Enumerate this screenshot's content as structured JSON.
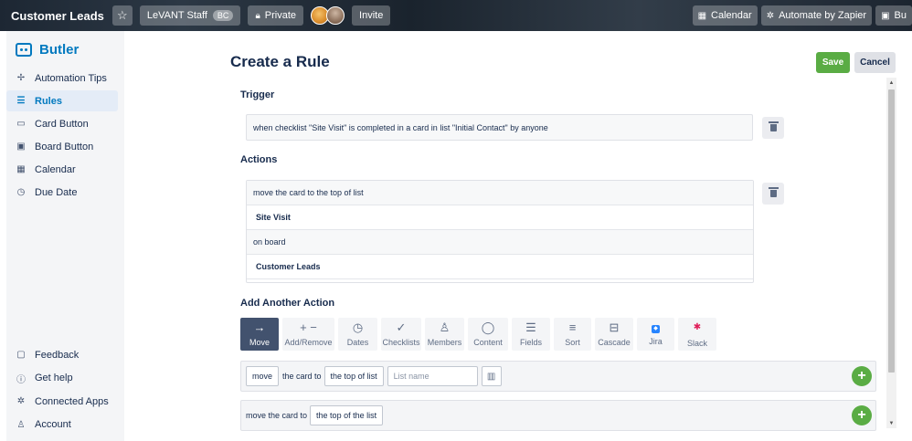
{
  "topbar": {
    "board_title": "Customer Leads",
    "star_icon": "star-icon",
    "team_label": "LeVANT Staff",
    "team_badge": "BC",
    "visibility_label": "Private",
    "invite_label": "Invite",
    "right_buttons": [
      {
        "label": "Calendar",
        "icon": "calendar-icon"
      },
      {
        "label": "Automate by Zapier",
        "icon": "gear-icon"
      },
      {
        "label": "Bu",
        "icon": "butler-icon"
      }
    ]
  },
  "sidebar": {
    "title": "Butler",
    "items": [
      {
        "label": "Automation Tips",
        "icon": "sparkle-icon",
        "active": false
      },
      {
        "label": "Rules",
        "icon": "sliders-icon",
        "active": true
      },
      {
        "label": "Card Button",
        "icon": "card-icon",
        "active": false
      },
      {
        "label": "Board Button",
        "icon": "board-icon",
        "active": false
      },
      {
        "label": "Calendar",
        "icon": "calendar-icon",
        "active": false
      },
      {
        "label": "Due Date",
        "icon": "clock-icon",
        "active": false
      }
    ],
    "bottom_items": [
      {
        "label": "Feedback",
        "icon": "chat-icon"
      },
      {
        "label": "Get help",
        "icon": "help-icon"
      },
      {
        "label": "Connected Apps",
        "icon": "gear-icon"
      },
      {
        "label": "Account",
        "icon": "user-icon"
      }
    ]
  },
  "main": {
    "title": "Create a Rule",
    "save_label": "Save",
    "cancel_label": "Cancel",
    "trigger_label": "Trigger",
    "trigger_text": "when checklist \"Site Visit\" is completed in a card in list \"Initial Contact\" by anyone",
    "actions_label": "Actions",
    "action_lines": [
      "move the card to the top of list",
      "Site Visit",
      "on board",
      "Customer Leads"
    ],
    "add_action_label": "Add Another Action",
    "tabs": [
      {
        "label": "Move",
        "icon": "arrow-right-icon",
        "active": true
      },
      {
        "label": "Add/Remove",
        "icon": "plus-minus-icon",
        "active": false
      },
      {
        "label": "Dates",
        "icon": "clock-icon",
        "active": false
      },
      {
        "label": "Checklists",
        "icon": "check-icon",
        "active": false
      },
      {
        "label": "Members",
        "icon": "user-icon",
        "active": false
      },
      {
        "label": "Content",
        "icon": "chat-icon",
        "active": false
      },
      {
        "label": "Fields",
        "icon": "lines-icon",
        "active": false
      },
      {
        "label": "Sort",
        "icon": "sort-icon",
        "active": false
      },
      {
        "label": "Cascade",
        "icon": "cascade-icon",
        "active": false
      },
      {
        "label": "Jira",
        "icon": "jira-icon",
        "active": false
      },
      {
        "label": "Slack",
        "icon": "slack-icon",
        "active": false
      }
    ],
    "action_row_1": {
      "verb": "move",
      "text": "the card to",
      "position": "the top of list",
      "list_placeholder": "List name"
    },
    "action_row_2": {
      "text": "move the card to",
      "position": "the top of the list"
    }
  },
  "colors": {
    "accent": "#0079bf",
    "save": "#5aac44",
    "active_tab": "#42526e"
  }
}
